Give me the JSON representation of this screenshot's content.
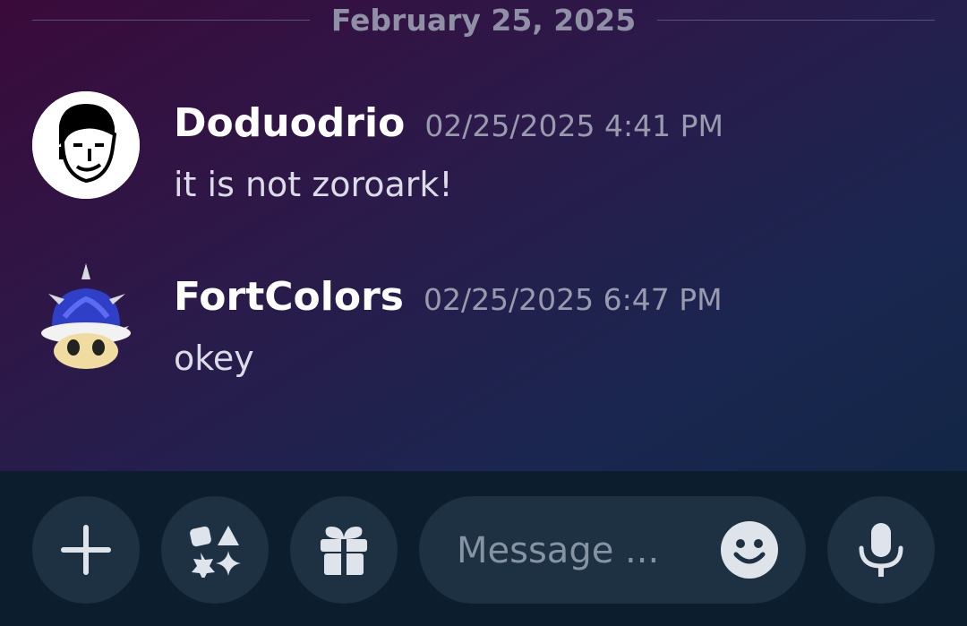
{
  "date_divider": "February 25, 2025",
  "messages": [
    {
      "author": "Doduodrio",
      "timestamp": "02/25/2025 4:41 PM",
      "text": "it is not zoroark!",
      "avatar": "pixel-face-avatar"
    },
    {
      "author": "FortColors",
      "timestamp": "02/25/2025 6:47 PM",
      "text": "okey",
      "avatar": "blue-spiny-shell-avatar"
    }
  ],
  "composer": {
    "placeholder": "Message ...",
    "buttons": [
      "plus-icon",
      "apps-icon",
      "gift-icon",
      "emoji-icon",
      "microphone-icon"
    ]
  },
  "colors": {
    "bar_background": "#0c1d2e",
    "button_background": "#1d3142",
    "timestamp": "#9a9aae"
  }
}
